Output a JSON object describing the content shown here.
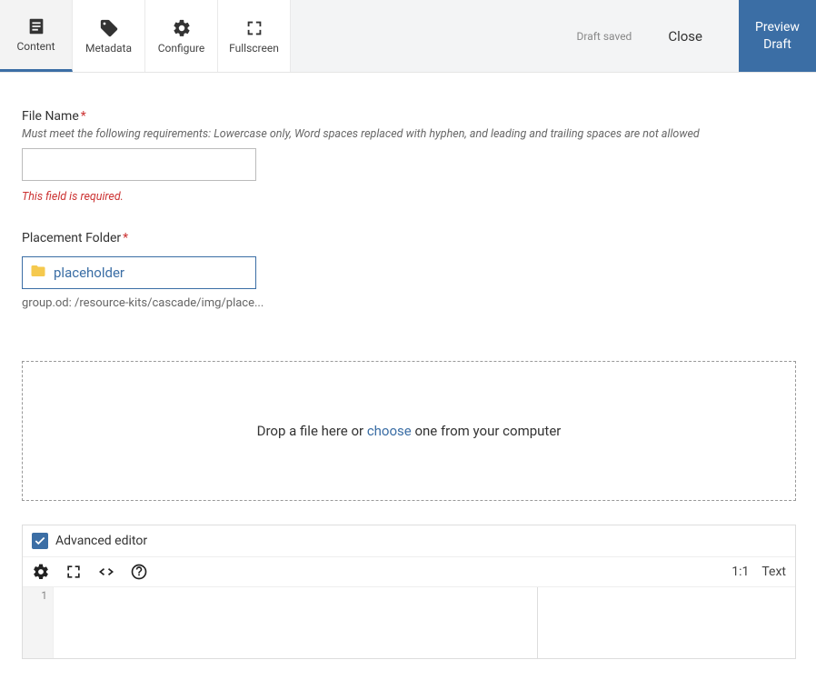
{
  "tabs": {
    "content": "Content",
    "metadata": "Metadata",
    "configure": "Configure",
    "fullscreen": "Fullscreen"
  },
  "topright": {
    "draft_saved": "Draft saved",
    "close": "Close",
    "preview_line1": "Preview",
    "preview_line2": "Draft"
  },
  "filename": {
    "label": "File Name",
    "req": "*",
    "hint": "Must meet the following requirements: Lowercase only, Word spaces replaced with hyphen, and leading and trailing spaces are not allowed",
    "value": "",
    "error": "This field is required."
  },
  "placement": {
    "label": "Placement Folder",
    "req": "*",
    "value": "placeholder",
    "path": "group.od: /resource-kits/cascade/img/place..."
  },
  "dropzone": {
    "before": "Drop a file here or ",
    "choose": "choose",
    "after": " one from your computer"
  },
  "editor": {
    "title": "Advanced editor",
    "pos": "1:1",
    "mode": "Text",
    "line1": "1"
  }
}
